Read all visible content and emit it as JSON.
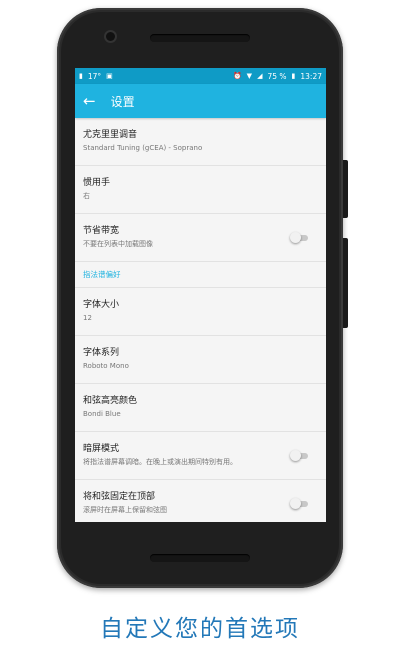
{
  "status_bar": {
    "temperature": "17°",
    "battery_percent": "75 %",
    "time": "13:27",
    "icons": [
      "notification-icon",
      "image-icon",
      "alarm-icon",
      "wifi-icon",
      "signal-icon",
      "battery-icon"
    ]
  },
  "app_bar": {
    "back_icon": "arrow-back-icon",
    "title": "设置"
  },
  "settings": [
    {
      "title": "尤克里里调音",
      "subtitle": "Standard Tuning (gCEA) - Soprano"
    },
    {
      "title": "惯用手",
      "subtitle": "右"
    },
    {
      "title": "节省带宽",
      "subtitle": "不要在列表中加载图像",
      "toggle": false
    }
  ],
  "section_header": "指法谱偏好",
  "settings2": [
    {
      "title": "字体大小",
      "subtitle": "12"
    },
    {
      "title": "字体系列",
      "subtitle": "Roboto Mono"
    },
    {
      "title": "和弦高亮颜色",
      "subtitle": "Bondi Blue"
    },
    {
      "title": "暗屏模式",
      "subtitle": "将指法谱屏幕调暗。在晚上或演出期间特别有用。",
      "toggle": false
    },
    {
      "title": "将和弦固定在顶部",
      "subtitle": "滚屏时在屏幕上保留和弦图",
      "toggle": false
    }
  ],
  "caption": "自定义您的首选项",
  "colors": {
    "accent": "#1fb3e0",
    "status_bar": "#0f9bc6",
    "caption": "#2378b8"
  }
}
